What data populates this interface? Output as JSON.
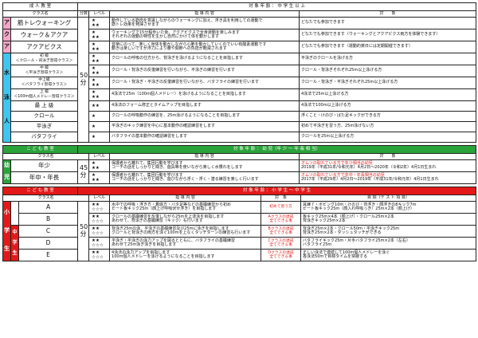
{
  "adult": {
    "band": "成 人 教 室",
    "target": "対 象 年 齢 ： 中 学 生 以 上",
    "headers": {
      "class": "クラス名",
      "minutes": "分数",
      "level": "レベル",
      "content": "指 導 内 容",
      "target": "対　　象"
    },
    "aqua_side": [
      "ア",
      "ク",
      "ア"
    ],
    "swim_side": [
      "水",
      "泳",
      "人"
    ],
    "minutes": [
      "50",
      "分"
    ],
    "aqua": [
      {
        "name": "筋トレウォーキング",
        "levels": [
          "★",
          "★★"
        ],
        "content": [
          "動作している筋肉を意識しながらのウォーキングに加え、浮き具を利用しての運動で",
          "筋トレ効果を発揮させます"
        ],
        "target": "どなたでも参加できます"
      },
      {
        "name": "ウォーク＆アクア",
        "levels": [
          "★",
          "★★"
        ],
        "content": [
          "ウォーキングで15分程歩いた後、アクアビクスで全身運動を楽しみます",
          "それぞれの運動の特性を生かし自然にかけて体を動かします"
        ],
        "target": "どなたでも参加できます（ウォーキングとアクアビクス両方を体験できます）"
      },
      {
        "name": "アクアビクス",
        "levels": [
          "★",
          "★★"
        ],
        "content": [
          "音楽にのって、楽しく身体を動かしながら心肺を動かしていくのでいい有酸素運動です",
          "動きは楽しいですが浮力により腰や関節への負担が軽減されます"
        ],
        "target": "どなたでも参加できます（運動的楽日には定期開催できます）"
      }
    ],
    "swim": [
      {
        "tag": "初 級",
        "name": "＜クロール・背泳ぎ習得クラス＞",
        "levels": [
          "★",
          "★★"
        ],
        "content": "クロールの呼吸の仕方から、背泳ぎを泳げるようになることを目指します",
        "target": "平泳ぎのクロールを泳げる方"
      },
      {
        "tag": "中 級",
        "name": "＜平泳ぎ習得クラス＞",
        "levels": [
          "★",
          "★★"
        ],
        "content": "クロール・背泳ぎの反復練習を行いながら、平泳ぎの練習を行います",
        "target": "クロール・背泳ぎそれぞれ25m以上泳げる方"
      },
      {
        "tag": "中上級",
        "name": "＜バタフライ習得クラス＞",
        "levels": [
          "★",
          "★★"
        ],
        "content": "クロール・背泳ぎ・平泳ぎの反復練習を行いながら、バタフライの練習を行います",
        "target": "クロール・背泳ぎ・平泳ぎそれぞれ25m以上泳げる方"
      },
      {
        "tag": "上 級",
        "name": "＜100m個人メドレー習得クラス＞",
        "levels": [
          "★",
          "★★"
        ],
        "content": "4泳法で25m（100m個人メドレー）を泳げるようになることを目指します",
        "target": "4泳法で25m以上泳げる方"
      },
      {
        "tag": "",
        "name": "最 上 級",
        "levels": [
          "★★"
        ],
        "content": "4泳法のフォーム修正とタイムアップを目指します",
        "target": "4泳法で100m以上泳げる方"
      },
      {
        "tag": "",
        "name": "クロール",
        "levels": [
          "★"
        ],
        "content": "クロールの呼吸動作の練習を、25m泳げるようになることを目指します",
        "target": "浮くこと・けのび・ばた足キックができる方"
      },
      {
        "tag": "",
        "name": "平泳ぎ",
        "levels": [
          "★"
        ],
        "content": "平泳ぎのキック練習を中心に基本動作の確認練習をします",
        "target": "初めて平泳ぎを習う方、25m泳げない方"
      },
      {
        "tag": "",
        "name": "バタフライ",
        "levels": [
          "★"
        ],
        "content": "バタフライの基本動作の確認練習をします",
        "target": "クロールを25m以上泳げる方"
      }
    ]
  },
  "kids": {
    "band": "こ ど も 教 室",
    "target": "対 象 年 齢 ： 幼 児（年 少 ～ 年 長 相 当）",
    "headers": {
      "class": "クラス名",
      "level": "レベル",
      "content": "指 導 内 容",
      "target": "対　　象"
    },
    "side": [
      "幼",
      "児"
    ],
    "minutes": [
      "45",
      "分"
    ],
    "rows": [
      {
        "name": "年少",
        "levels": [
          "★",
          "★★"
        ],
        "content": [
          "保護者から離れて、集団行動を学びます",
          "コーチの話をしっかりと聞き、遊具等を使いながら楽しく水慣れをします"
        ],
        "target": [
          "オムツの取れている方で年少相当の幼児",
          "2019年（平成31年/令和元年）4月2日～2020年（令和2年）4月1日生まれ"
        ]
      },
      {
        "name": "年中・年長",
        "levels": [
          "★",
          "★★"
        ],
        "content": [
          "保護者から離れて、集団行動を学びます",
          "コーチの話をしっかりと聞き、遊びながら浮く・浮く・潜る練習を楽しく行います"
        ],
        "target": [
          "オムツの取れている方で年中・年長相当の幼児",
          "2017年（平成29年）4月2日～2019年（平成31年/令和元年）4月1日生まれ"
        ]
      }
    ]
  },
  "junior": {
    "band": "こ ど も 教 室",
    "target": "対 象 年 齢 ： 小 学 生 ～ 中 学 生",
    "headers": {
      "class": "クラス名",
      "level": "レベル",
      "content": "指 導 内 容",
      "target": "対　象",
      "goal": "目 標（テ ス ト 項 目）"
    },
    "side_outer": [
      "小",
      "学",
      "生"
    ],
    "side_inner": [
      "中",
      "学",
      "生"
    ],
    "minutes": [
      "50",
      "分"
    ],
    "rows": [
      {
        "name": "A",
        "levels": [
          "★★",
          "☆☆☆"
        ],
        "content": [
          "水中での呼吸・浮き方・着底方・バタ足等などの基礎練習から初め",
          "ビート板キック25m（顔上げ呼吸伏せ浮き）を目指します"
        ],
        "target": "初めて習う方",
        "goal": [
          "耳練７・ボビング10m・けのび・背浮き・顔浮きの8キック7m",
          "ビート板キック25m（顔入れ呼吸っき）25m×2本（顔上げ）"
        ]
      },
      {
        "name": "B",
        "levels": [
          "★★",
          "☆☆☆"
        ],
        "content": [
          "クロールの基礎練習を反復しながら25mを上達泳を目指します",
          "あわせて、背泳ぎの基礎練習（キック）も行います"
        ],
        "target": "Aクラスの達成",
        "goal": [
          "板キック25m×4本（顔上げ）・クロール25m×2本",
          "背泳ぎキック25m×2本"
        ]
      },
      {
        "name": "C",
        "levels": [
          "★★",
          "☆☆☆"
        ],
        "content": [
          "背泳ぎ25mの泳、平泳ぎの基礎練習及び25mに泳ぎを目指します",
          "クロールと背泳ぎの両方を泳ぐ100mを上なくタッチターンの練習も行います"
        ],
        "target": "Bクラスの達成",
        "goal": [
          "背泳ぎ25m×2本・クロール50m・平泳ぎキック25m",
          "背泳ぎ25m×2本・ダッシュタッチができる"
        ]
      },
      {
        "name": "D",
        "levels": [
          "★★",
          "☆☆☆"
        ],
        "content": [
          "平泳ぎ・平泳ぎの泳力アップを図るとともに、バタフライの基礎練習",
          "あわせて25m泳ぎ泳ぎを目指します"
        ],
        "target": "Cクラスの達成",
        "goal": [
          "バタフライキック25m・片手バタフライ25m×2本（左右）",
          "バタフライ25m"
        ]
      },
      {
        "name": "E",
        "levels": [
          "★★",
          "☆☆☆"
        ],
        "content": [
          "4泳法の泳力アップを目指します",
          "100m個人メドレーを泳げるようになることを目指します"
        ],
        "target": "Dクラスの達成",
        "goal": [
          "正しい泳法で連続して100m個人メドレーを泳ぐ",
          "各泳法50mで目標タイムを突破する"
        ]
      }
    ],
    "target_sub": "全てできる事"
  }
}
